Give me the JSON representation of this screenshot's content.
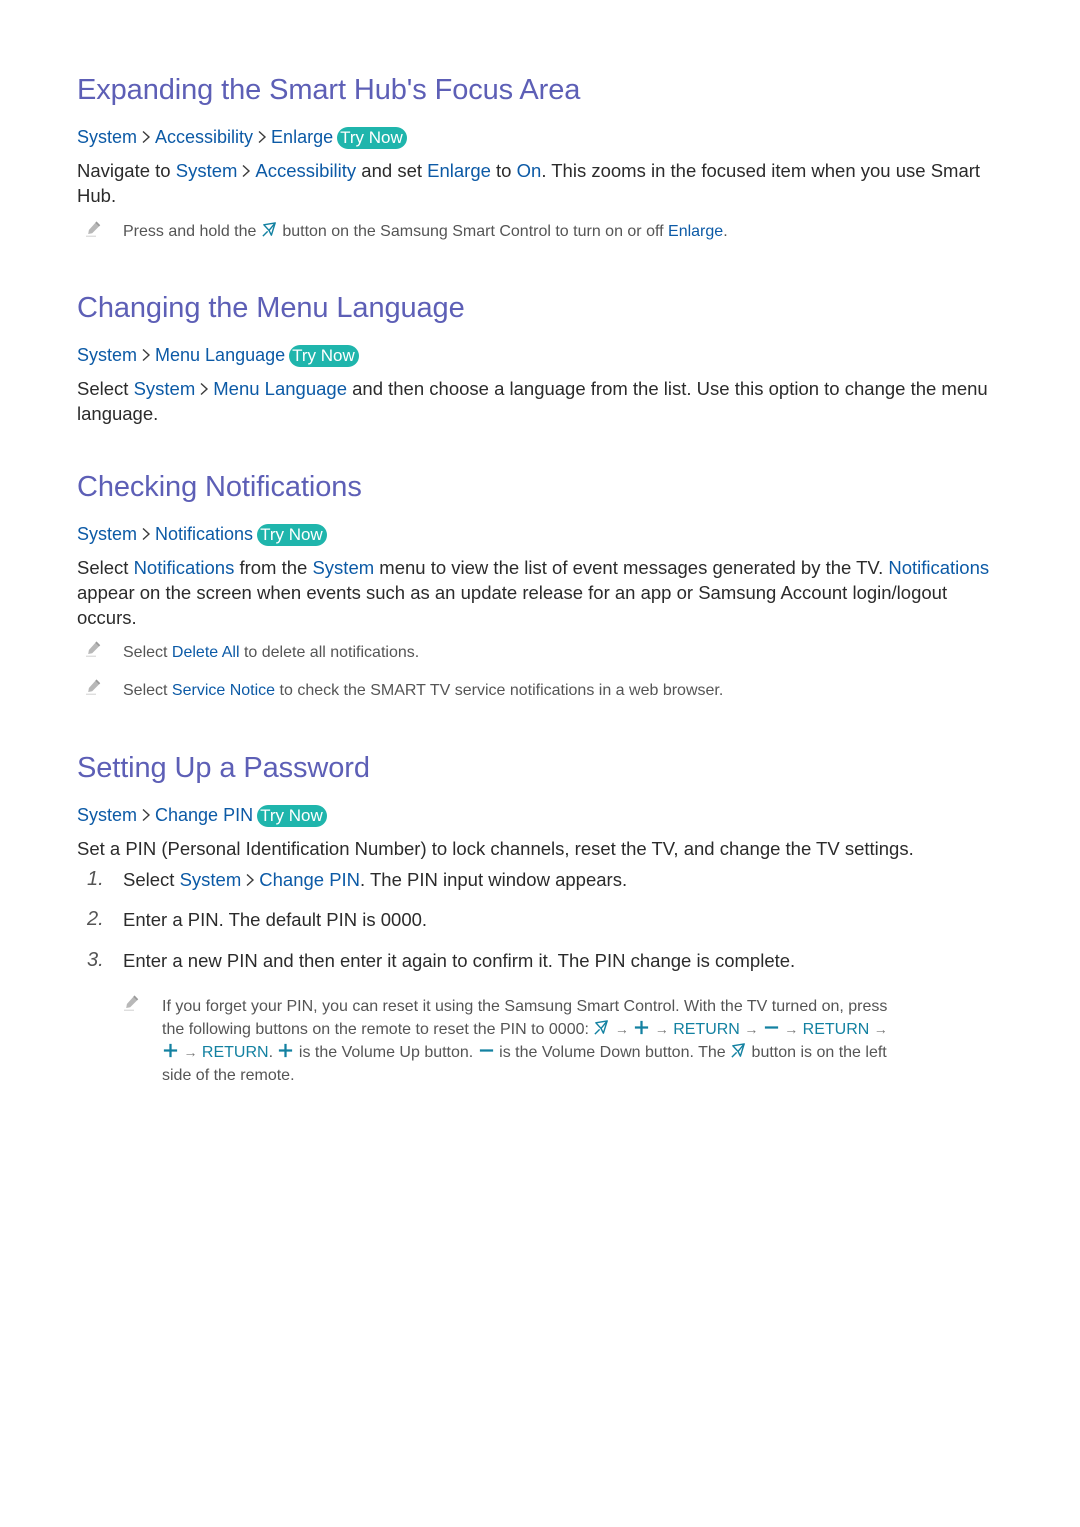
{
  "icons": {
    "note": "pencil-icon",
    "separator": "chevron-right-icon",
    "smart_button": "smart-hub-button-icon",
    "volume_up": "plus-icon",
    "volume_down": "minus-icon",
    "arrow": "right-arrow-icon"
  },
  "colors": {
    "heading": "#5d5fb6",
    "link": "#0c5aa6",
    "try_now_badge": "#1fb5ac",
    "remote_key": "#1381a1",
    "body_text": "#2b2b2b",
    "note_text": "#555555"
  },
  "try_now_label": "Try Now",
  "sections": [
    {
      "title": "Expanding the Smart Hub's Focus Area",
      "path": [
        "System",
        "Accessibility",
        "Enlarge"
      ],
      "body": {
        "t1": "Navigate to ",
        "l1": "System",
        "l2": "Accessibility",
        "t2": " and set ",
        "l3": "Enlarge",
        "t3": " to ",
        "l4": "On",
        "t4": ". This zooms in the focused item when you use Smart Hub."
      },
      "note": {
        "t1": "Press and hold the ",
        "t2": " button on the Samsung Smart Control to turn on or off ",
        "l1": "Enlarge",
        "t3": "."
      }
    },
    {
      "title": "Changing the Menu Language",
      "path": [
        "System",
        "Menu Language"
      ],
      "body": {
        "t1": "Select ",
        "l1": "System",
        "l2": "Menu Language",
        "t2": " and then choose a language from the list. Use this option to change the menu language."
      }
    },
    {
      "title": "Checking Notifications",
      "path": [
        "System",
        "Notifications"
      ],
      "body": {
        "t1": "Select ",
        "l1": "Notifications",
        "t2": " from the ",
        "l2": "System",
        "t3": " menu to view the list of event messages generated by the TV. ",
        "l3": "Notifications",
        "t4": " appear on the screen when events such as an update release for an app or Samsung Account login/logout occurs."
      },
      "notes": [
        {
          "t1": "Select ",
          "l1": "Delete All",
          "t2": " to delete all notifications."
        },
        {
          "t1": "Select ",
          "l1": "Service Notice",
          "t2": " to check the SMART TV service notifications in a web browser."
        }
      ]
    },
    {
      "title": "Setting Up a Password",
      "path": [
        "System",
        "Change PIN"
      ],
      "body": "Set a PIN (Personal Identification Number) to lock channels, reset the TV, and change the TV settings.",
      "steps": [
        {
          "num": "1.",
          "t1": "Select ",
          "l1": "System",
          "l2": "Change PIN",
          "t2": ". The PIN input window appears."
        },
        {
          "num": "2.",
          "t1": "Enter a PIN. The default PIN is 0000."
        },
        {
          "num": "3.",
          "t1": "Enter a new PIN and then enter it again to confirm it. The PIN change is complete."
        }
      ],
      "note": {
        "line1": "If you forget your PIN, you can reset it using the Samsung Smart Control. With the TV turned on, press",
        "line2_a": "the following buttons on the remote to reset the PIN to 0000: ",
        "return_label": "RETURN",
        "line3_b": " is the Volume Up button. ",
        "line3_c": " is the Volume Down button. The ",
        "line3_d": " button is on the left",
        "line4": "side of the remote."
      }
    }
  ]
}
